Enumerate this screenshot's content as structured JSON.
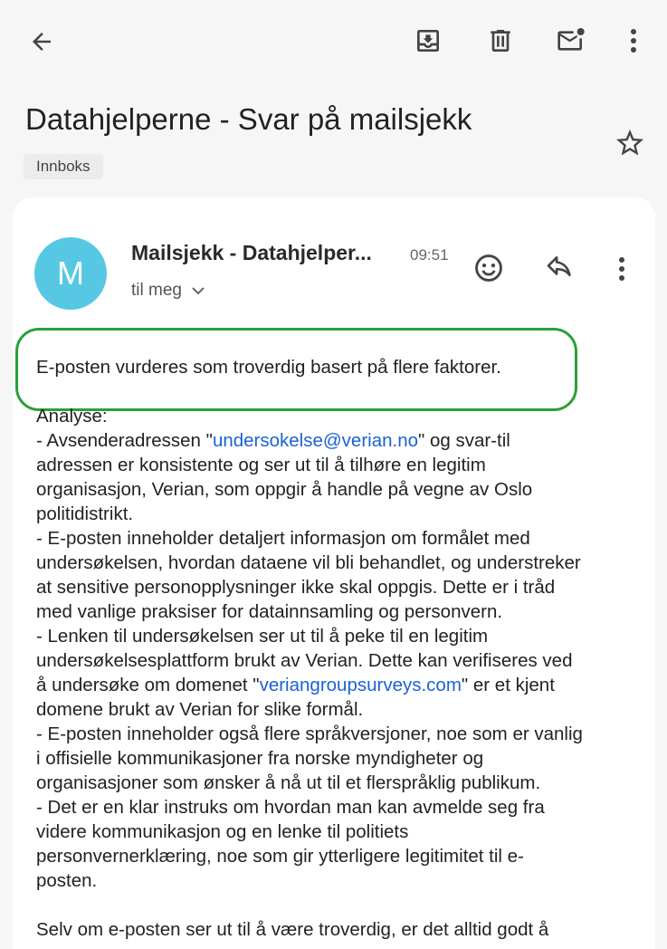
{
  "toolbar": {
    "back_icon": "arrow-back-icon",
    "archive_icon": "archive-icon",
    "delete_icon": "trash-icon",
    "mark_unread_icon": "mark-unread-icon",
    "more_icon": "more-vert-icon"
  },
  "email": {
    "subject": "Datahjelperne - Svar på mailsjekk",
    "label": "Innboks",
    "avatar_letter": "M",
    "avatar_color": "#56c8e4",
    "sender": "Mailsjekk - Datahjelper...",
    "time": "09:51",
    "recipient": "til meg",
    "summary": "E-posten vurderes som troverdig basert på flere faktorer.",
    "analysis_heading": "Analyse:",
    "lines": [
      [
        "- Avsenderadressen \"",
        "undersokelse@verian.no",
        "\" og svar-til"
      ],
      [
        "adressen er konsistente og ser ut til å tilhøre en legitim"
      ],
      [
        "organisasjon, Verian, som oppgir å handle på vegne av Oslo"
      ],
      [
        "politidistrikt."
      ],
      [
        "- E-posten inneholder detaljert informasjon om formålet med"
      ],
      [
        "undersøkelsen, hvordan dataene vil bli behandlet, og understreker"
      ],
      [
        "at sensitive personopplysninger ikke skal oppgis. Dette er i tråd"
      ],
      [
        "med vanlige praksiser for datainnsamling og personvern."
      ],
      [
        "- Lenken til undersøkelsen ser ut til å peke til en legitim"
      ],
      [
        "undersøkelsesplattform brukt av Verian. Dette kan verifiseres ved"
      ],
      [
        "å undersøke om domenet \"",
        "veriangroupsurveys.com",
        "\" er et kjent"
      ],
      [
        "domene brukt av Verian for slike formål."
      ],
      [
        "- E-posten inneholder også flere språkversjoner, noe som er vanlig"
      ],
      [
        "i offisielle kommunikasjoner fra norske myndigheter og"
      ],
      [
        "organisasjoner som ønsker å nå ut til et flerspråklig publikum."
      ],
      [
        "- Det er en klar instruks om hvordan man kan avmelde seg fra"
      ],
      [
        "videre kommunikasjon og en lenke til politiets"
      ],
      [
        "personvernerklæring, noe som gir ytterligere legitimitet til e-"
      ],
      [
        "posten."
      ]
    ],
    "closing_partial": "Selv om e-posten ser ut til å være troverdig, er det alltid godt å"
  },
  "colors": {
    "link": "#1a62d6",
    "highlight": "#2aa038"
  }
}
